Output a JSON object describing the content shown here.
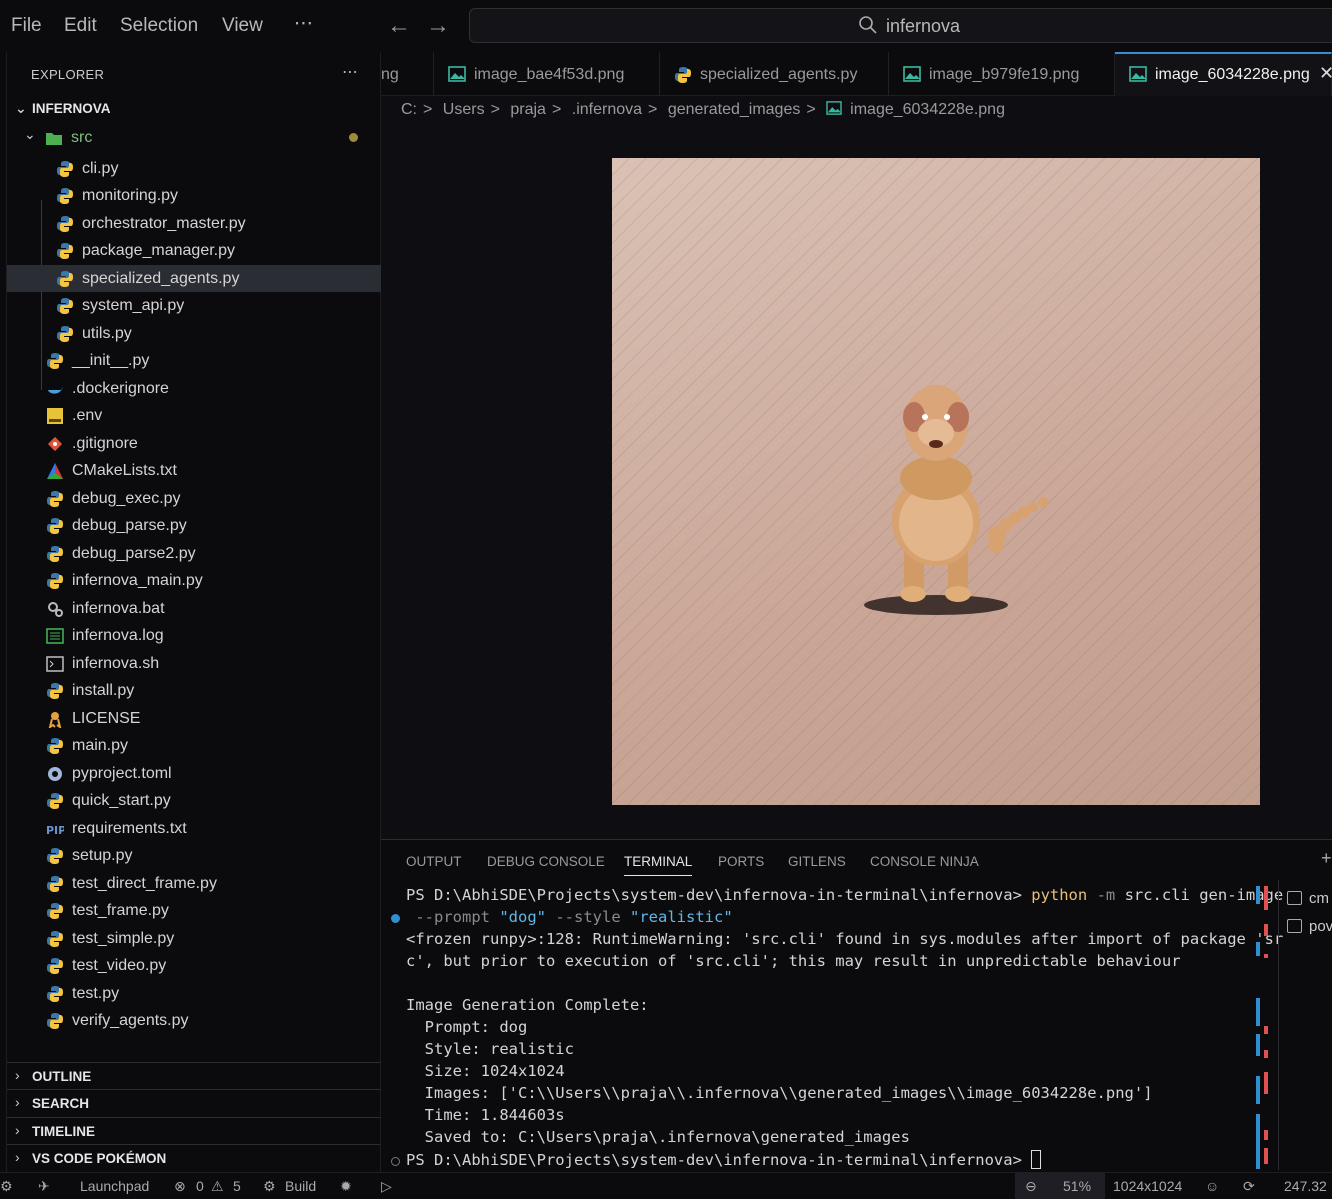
{
  "titlebar": {
    "menu": [
      "File",
      "Edit",
      "Selection",
      "View",
      "⋯"
    ],
    "search_text": "infernova"
  },
  "explorer": {
    "title": "EXPLORER",
    "more": "⋯",
    "root": "INFERNOVA",
    "folder": "src",
    "src_files": [
      "cli.py",
      "monitoring.py",
      "orchestrator_master.py",
      "package_manager.py",
      "specialized_agents.py",
      "system_api.py",
      "utils.py"
    ],
    "root_files": [
      "__init__.py",
      ".dockerignore",
      ".env",
      ".gitignore",
      "CMakeLists.txt",
      "debug_exec.py",
      "debug_parse.py",
      "debug_parse2.py",
      "infernova_main.py",
      "infernova.bat",
      "infernova.log",
      "infernova.sh",
      "install.py",
      "LICENSE",
      "main.py",
      "pyproject.toml",
      "quick_start.py",
      "requirements.txt",
      "setup.py",
      "test_direct_frame.py",
      "test_frame.py",
      "test_simple.py",
      "test_video.py",
      "test.py",
      "verify_agents.py"
    ],
    "sections": [
      "OUTLINE",
      "SEARCH",
      "TIMELINE",
      "VS CODE POKÉMON"
    ]
  },
  "tabs": [
    {
      "label": "ng"
    },
    {
      "label": "image_bae4f53d.png"
    },
    {
      "label": "specialized_agents.py"
    },
    {
      "label": "image_b979fe19.png"
    },
    {
      "label": "image_6034228e.png",
      "close": "✕"
    }
  ],
  "breadcrumb": [
    "C:",
    ">",
    "Users",
    ">",
    "praja",
    ">",
    ".infernova",
    ">",
    "generated_images",
    ">",
    "image_6034228e.png"
  ],
  "panel": {
    "tabs": [
      "OUTPUT",
      "DEBUG CONSOLE",
      "TERMINAL",
      "PORTS",
      "GITLENS",
      "CONSOLE NINJA"
    ],
    "plus": "+",
    "terminal": {
      "l1_prompt": "PS D:\\AbhiSDE\\Projects\\system-dev\\infernova-in-terminal\\infernova> ",
      "l1_cmd": "python",
      "l1_flag": " -m ",
      "l1_rest": "src.cli gen-image",
      "l2_flag1": " --prompt ",
      "l2_val1": "\"dog\"",
      "l2_flag2": " --style ",
      "l2_val2": "\"realistic\"",
      "l3": "<frozen runpy>:128: RuntimeWarning: 'src.cli' found in sys.modules after import of package 'sr",
      "l4": "c', but prior to execution of 'src.cli'; this may result in unpredictable behaviour",
      "l6": "Image Generation Complete:",
      "l7": "  Prompt: dog",
      "l8": "  Style: realistic",
      "l9": "  Size: 1024x1024",
      "l10": "  Images: ['C:\\\\Users\\\\praja\\\\.infernova\\\\generated_images\\\\image_6034228e.png']",
      "l11": "  Time: 1.844603s",
      "l12": "  Saved to: C:\\Users\\praja\\.infernova\\generated_images",
      "l13": "PS D:\\AbhiSDE\\Projects\\system-dev\\infernova-in-terminal\\infernova> "
    },
    "terminal_list": [
      "cm",
      "pov"
    ]
  },
  "statusbar": {
    "launchpad": "Launchpad",
    "errors": "0",
    "warnings": "5",
    "build": "Build",
    "zoom": "51%",
    "dimensions": "1024x1024",
    "filesize": "247.32"
  },
  "colors": {
    "accent": "#3a8bd6",
    "python_blue": "#3b77a8",
    "python_yellow": "#f4c542",
    "dog_body": "#d9a070"
  }
}
